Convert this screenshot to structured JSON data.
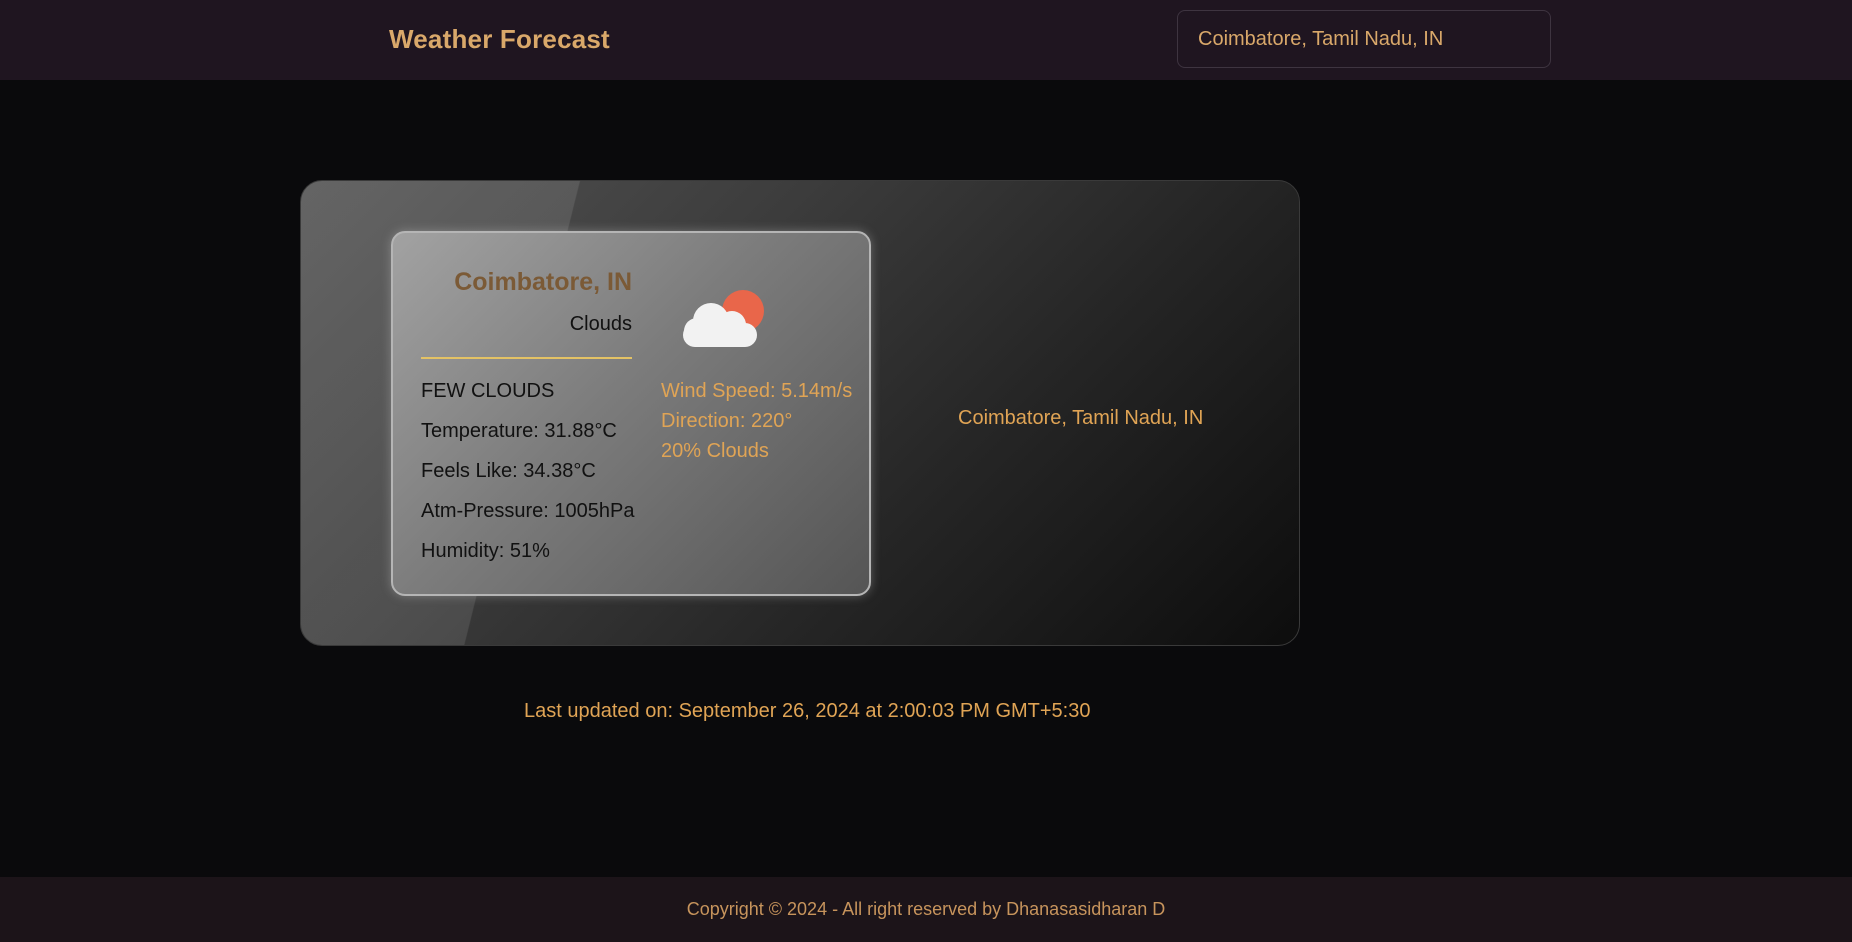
{
  "header": {
    "title": "Weather Forecast",
    "search": {
      "value": "Coimbatore, Tamil Nadu, IN",
      "placeholder": "Coimbatore, Tamil Nadu, IN"
    }
  },
  "weather": {
    "city": "Coimbatore, IN",
    "condition": "Clouds",
    "icon": "partly-cloudy-icon",
    "stats": {
      "description": "FEW CLOUDS",
      "temperature": "Temperature: 31.88°C",
      "feels_like": "Feels Like: 34.38°C",
      "pressure": "Atm-Pressure: 1005hPa",
      "humidity": "Humidity: 51%"
    },
    "wind": {
      "speed": "Wind Speed: 5.14m/s",
      "direction": "Direction: 220°",
      "clouds": "20% Clouds"
    },
    "location": "Coimbatore, Tamil Nadu, IN"
  },
  "last_updated": "Last updated on: September 26, 2024 at 2:00:03 PM GMT+5:30",
  "footer": {
    "copyright": "Copyright © 2024 - All right reserved by Dhanasasidharan D"
  },
  "colors": {
    "accent": "#e0a455",
    "header_bg": "#1f1520",
    "page_bg": "#0a0a0c",
    "divider": "#e3c265",
    "sun": "#e9664a"
  }
}
